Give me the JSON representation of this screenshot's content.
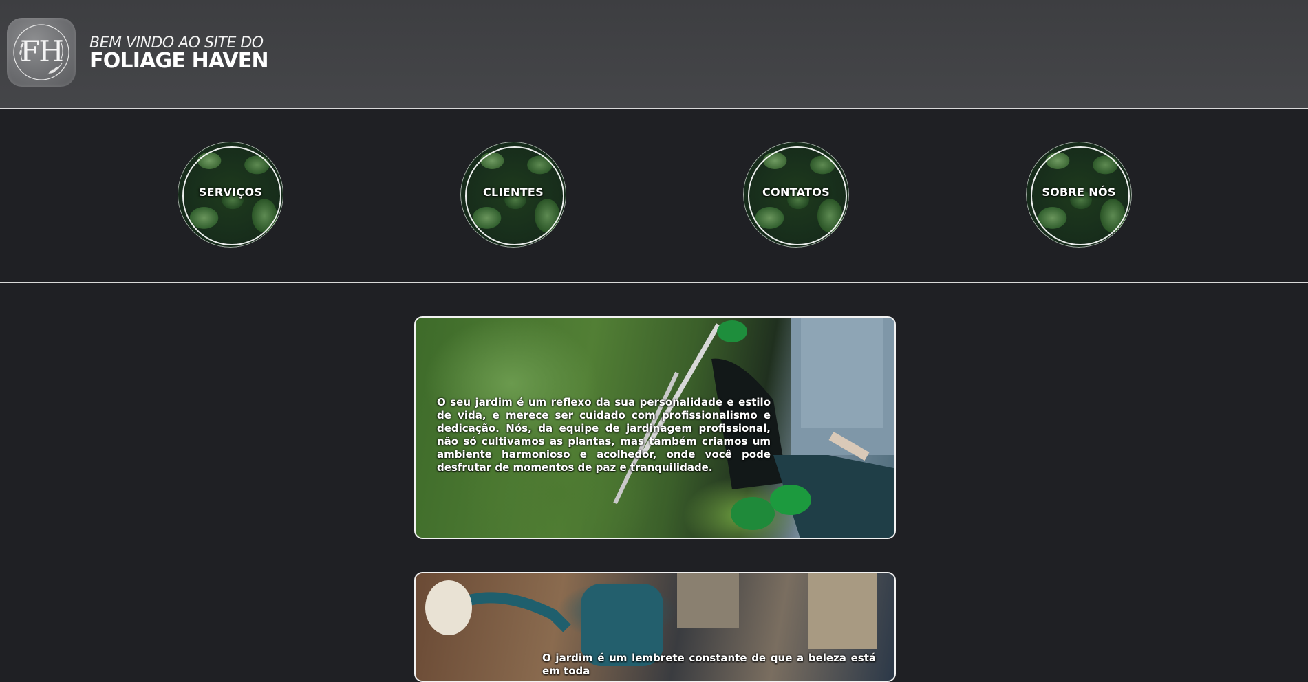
{
  "header": {
    "logo_text": "FH",
    "welcome_line": "BEM VINDO AO SITE DO",
    "brand_name": "FOLIAGE HAVEN"
  },
  "nav": {
    "items": [
      {
        "label": "SERVIÇOS"
      },
      {
        "label": "CLIENTES"
      },
      {
        "label": "CONTATOS"
      },
      {
        "label": "SOBRE NÓS"
      }
    ]
  },
  "cards": [
    {
      "text": "O seu jardim é um reflexo da sua personalidade e estilo de vida, e merece ser cuidado com profissionalismo e dedicação. Nós, da equipe de jardinagem profissional, não só cultivamos as plantas, mas também criamos um ambiente harmonioso e acolhedor, onde você pode desfrutar de momentos de paz e tranquilidade."
    },
    {
      "text": "O jardim é um lembrete constante de que a beleza está em toda"
    }
  ],
  "colors": {
    "background": "#1f2024",
    "header": "#424346",
    "divider": "#d9d9d9",
    "text": "#ffffff"
  }
}
